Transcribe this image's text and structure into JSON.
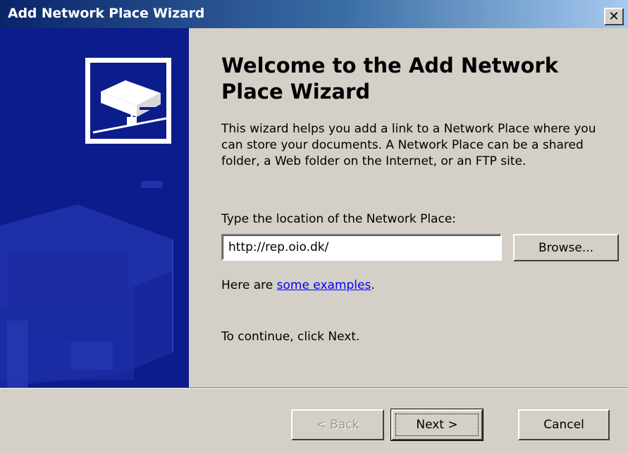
{
  "window": {
    "title": "Add Network Place Wizard",
    "close_glyph": "✕",
    "accent": "#0a246a",
    "sidebar_color": "#0c1c8c"
  },
  "main": {
    "heading": "Welcome to the Add Network Place Wizard",
    "description": "This wizard helps you add a link to a Network Place where you can store your documents. A Network Place can be a shared folder, a Web folder on the Internet, or an FTP site.",
    "location_label": "Type the location of the Network Place:",
    "location_value": "http://rep.oio.dk/",
    "browse_label": "Browse...",
    "examples_prefix": "Here are ",
    "examples_link": "some examples",
    "examples_suffix": ".",
    "continue_text": "To continue, click Next."
  },
  "footer": {
    "back_label": "< Back",
    "next_label": "Next >",
    "cancel_label": "Cancel"
  }
}
